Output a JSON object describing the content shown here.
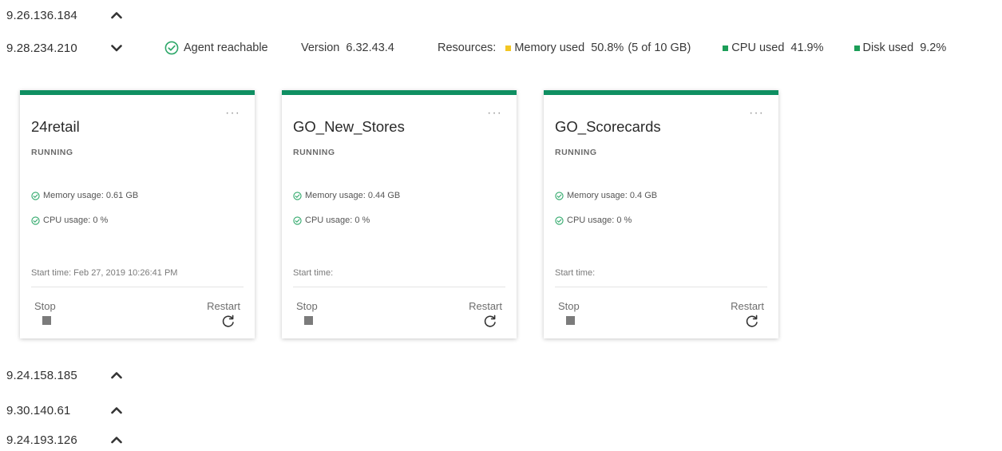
{
  "hosts": [
    {
      "ip": "9.26.136.184",
      "expanded": false
    },
    {
      "ip": "9.28.234.210",
      "expanded": true
    },
    {
      "ip": "9.24.158.185",
      "expanded": false
    },
    {
      "ip": "9.30.140.61",
      "expanded": false
    },
    {
      "ip": "9.24.193.126",
      "expanded": false
    }
  ],
  "expanded_host": {
    "status": "Agent reachable",
    "version_label": "Version",
    "version_value": "6.32.43.4",
    "resources_label": "Resources:",
    "memory_label": "Memory used",
    "memory_value": "50.8%",
    "memory_detail": "(5 of 10 GB)",
    "cpu_label": "CPU used",
    "cpu_value": "41.9%",
    "disk_label": "Disk used",
    "disk_value": "9.2%"
  },
  "colors": {
    "accent": "#0f8f62",
    "ok_green": "#2fa86a",
    "memory": "#f3c623",
    "cpu": "#1c9e58",
    "disk": "#1c9e58"
  },
  "cards": [
    {
      "name": "24retail",
      "state": "RUNNING",
      "memory": "Memory usage: 0.61 GB",
      "cpu": "CPU usage: 0 %",
      "start": "Start time: Feb 27, 2019 10:26:41 PM",
      "stop_label": "Stop",
      "restart_label": "Restart",
      "menu": "···"
    },
    {
      "name": "GO_New_Stores",
      "state": "RUNNING",
      "memory": "Memory usage: 0.44 GB",
      "cpu": "CPU usage: 0 %",
      "start": "Start time:",
      "stop_label": "Stop",
      "restart_label": "Restart",
      "menu": "···"
    },
    {
      "name": "GO_Scorecards",
      "state": "RUNNING",
      "memory": "Memory usage: 0.4 GB",
      "cpu": "CPU usage: 0 %",
      "start": "Start time:",
      "stop_label": "Stop",
      "restart_label": "Restart",
      "menu": "···"
    }
  ],
  "icons": {
    "collapsed": "chevron-up-icon",
    "expanded": "chevron-down-icon",
    "status": "check-circle-icon",
    "stop": "stop-icon",
    "restart": "restart-icon",
    "menu": "more-icon"
  }
}
